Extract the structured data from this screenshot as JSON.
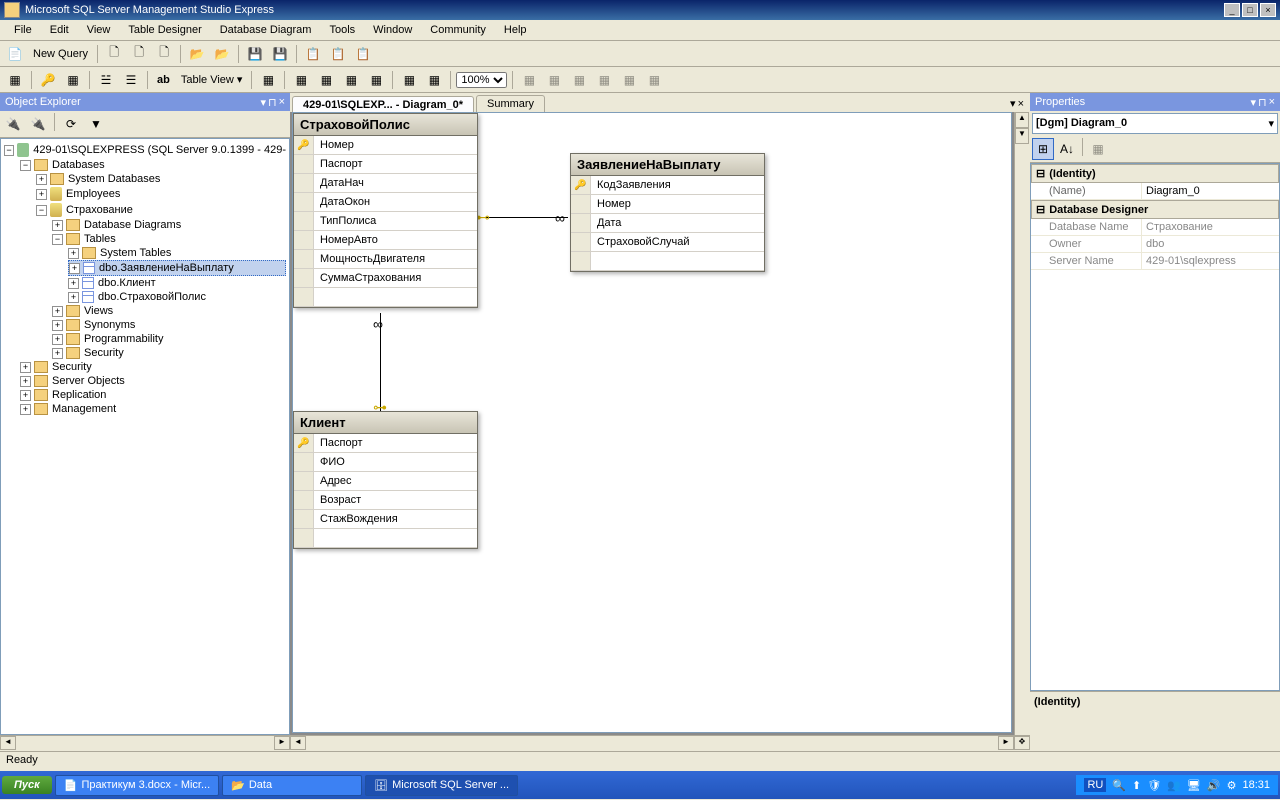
{
  "title": "Microsoft SQL Server Management Studio Express",
  "menu": [
    "File",
    "Edit",
    "View",
    "Table Designer",
    "Database Diagram",
    "Tools",
    "Window",
    "Community",
    "Help"
  ],
  "newQuery": "New Query",
  "tableView": "Table View",
  "zoom": "100%",
  "objectExplorer": {
    "title": "Object Explorer",
    "root": "429-01\\SQLEXPRESS (SQL Server 9.0.1399 - 429-",
    "databases": "Databases",
    "sysdb": "System Databases",
    "employees": "Employees",
    "insurance": "Страхование",
    "dbdiagrams": "Database Diagrams",
    "tables": "Tables",
    "systables": "System Tables",
    "t1": "dbo.ЗаявлениеНаВыплату",
    "t2": "dbo.Клиент",
    "t3": "dbo.СтраховойПолис",
    "views": "Views",
    "synonyms": "Synonyms",
    "programmability": "Programmability",
    "security": "Security",
    "security2": "Security",
    "serverobj": "Server Objects",
    "replication": "Replication",
    "management": "Management"
  },
  "tabs": {
    "active": "429-01\\SQLEXP... - Diagram_0*",
    "summary": "Summary"
  },
  "diagram": {
    "table1": {
      "name": "СтраховойПолис",
      "cols": [
        "Номер",
        "Паспорт",
        "ДатаНач",
        "ДатаОкон",
        "ТипПолиса",
        "НомерАвто",
        "МощностьДвигателя",
        "СуммаСтрахования"
      ],
      "pk": 0
    },
    "table2": {
      "name": "ЗаявлениеНаВыплату",
      "cols": [
        "КодЗаявления",
        "Номер",
        "Дата",
        "СтраховойСлучай"
      ],
      "pk": 0
    },
    "table3": {
      "name": "Клиент",
      "cols": [
        "Паспорт",
        "ФИО",
        "Адрес",
        "Возраст",
        "СтажВождения"
      ],
      "pk": 0
    }
  },
  "properties": {
    "title": "Properties",
    "header": "[Dgm] Diagram_0",
    "identity": "(Identity)",
    "name": "(Name)",
    "nameVal": "Diagram_0",
    "dbdesigner": "Database Designer",
    "dbname": "Database Name",
    "dbnameVal": "Страхование",
    "owner": "Owner",
    "ownerVal": "dbo",
    "server": "Server Name",
    "serverVal": "429-01\\sqlexpress",
    "desc": "(Identity)"
  },
  "status": "Ready",
  "taskbar": {
    "start": "Пуск",
    "items": [
      "Практикум 3.docx - Micr...",
      "Data",
      "Microsoft SQL Server ..."
    ],
    "time": "18:31",
    "lang": "RU"
  }
}
